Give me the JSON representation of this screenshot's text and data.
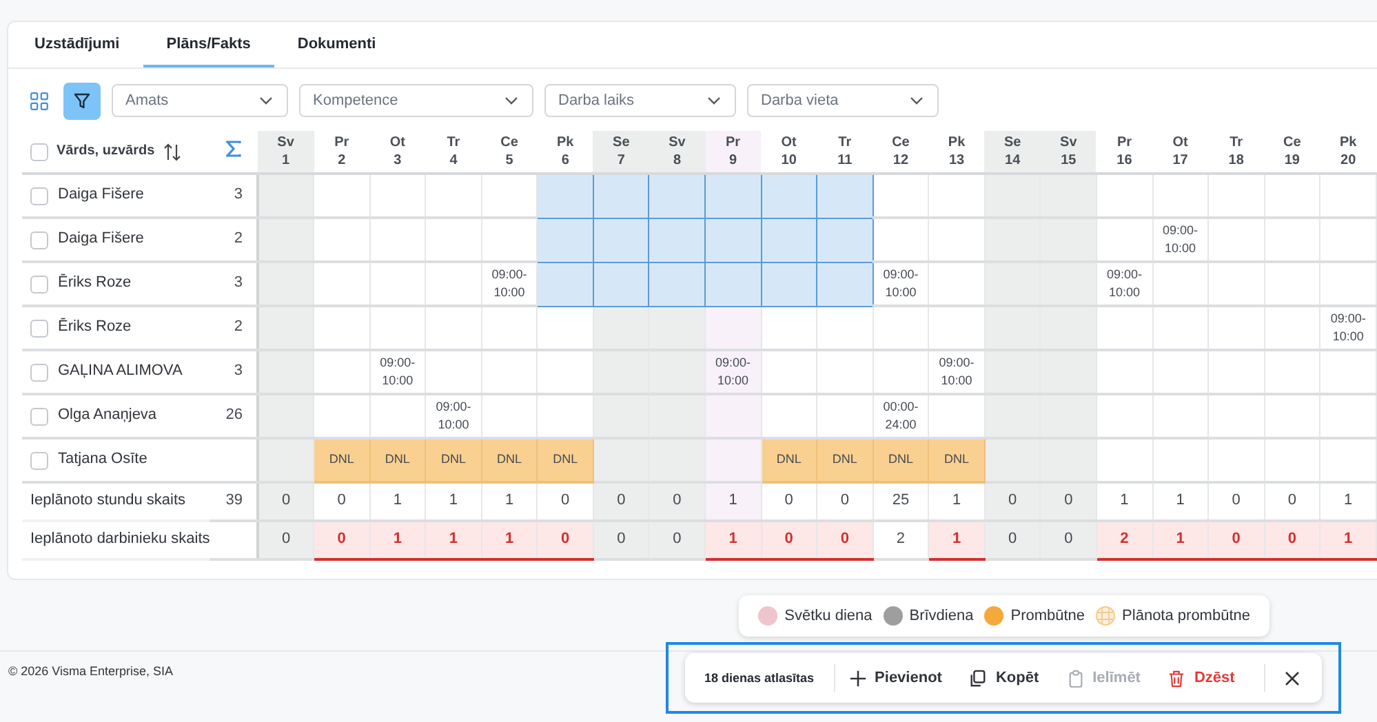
{
  "tabs": [
    {
      "label": "Uzstādījumi",
      "selected": false
    },
    {
      "label": "Plāns/Fakts",
      "selected": true
    },
    {
      "label": "Dokumenti",
      "selected": false
    }
  ],
  "toolbar": {
    "filter_active": true,
    "dropdowns": [
      {
        "placeholder": "Amats"
      },
      {
        "placeholder": "Kompetence"
      },
      {
        "placeholder": "Darba laiks"
      },
      {
        "placeholder": "Darba vieta"
      }
    ]
  },
  "table": {
    "name_header": "Vārds, uzvārds",
    "select_all_checked": false,
    "days": [
      {
        "weekday": "Sv",
        "date": "1",
        "kind": "weekend"
      },
      {
        "weekday": "Pr",
        "date": "2",
        "kind": "workday"
      },
      {
        "weekday": "Ot",
        "date": "3",
        "kind": "workday"
      },
      {
        "weekday": "Tr",
        "date": "4",
        "kind": "workday"
      },
      {
        "weekday": "Ce",
        "date": "5",
        "kind": "workday"
      },
      {
        "weekday": "Pk",
        "date": "6",
        "kind": "workday"
      },
      {
        "weekday": "Se",
        "date": "7",
        "kind": "weekend"
      },
      {
        "weekday": "Sv",
        "date": "8",
        "kind": "weekend"
      },
      {
        "weekday": "Pr",
        "date": "9",
        "kind": "holiday"
      },
      {
        "weekday": "Ot",
        "date": "10",
        "kind": "workday"
      },
      {
        "weekday": "Tr",
        "date": "11",
        "kind": "workday"
      },
      {
        "weekday": "Ce",
        "date": "12",
        "kind": "workday"
      },
      {
        "weekday": "Pk",
        "date": "13",
        "kind": "workday"
      },
      {
        "weekday": "Se",
        "date": "14",
        "kind": "weekend"
      },
      {
        "weekday": "Sv",
        "date": "15",
        "kind": "weekend"
      },
      {
        "weekday": "Pr",
        "date": "16",
        "kind": "workday"
      },
      {
        "weekday": "Ot",
        "date": "17",
        "kind": "workday"
      },
      {
        "weekday": "Tr",
        "date": "18",
        "kind": "workday"
      },
      {
        "weekday": "Ce",
        "date": "19",
        "kind": "workday"
      },
      {
        "weekday": "Pk",
        "date": "20",
        "kind": "workday"
      }
    ],
    "rows": [
      {
        "name": "Daiga Fišere",
        "count": "3",
        "checked": false,
        "cells": [
          {
            "kind": "empty",
            "selected": false
          },
          {
            "kind": "empty",
            "selected": false
          },
          {
            "kind": "empty",
            "selected": false
          },
          {
            "kind": "empty",
            "selected": false
          },
          {
            "kind": "empty",
            "selected": false
          },
          {
            "kind": "empty",
            "selected": true
          },
          {
            "kind": "empty",
            "selected": true
          },
          {
            "kind": "empty",
            "selected": true
          },
          {
            "kind": "empty",
            "selected": true
          },
          {
            "kind": "empty",
            "selected": true
          },
          {
            "kind": "empty",
            "selected": true
          },
          {
            "kind": "empty",
            "selected": false
          },
          {
            "kind": "empty",
            "selected": false
          },
          {
            "kind": "empty",
            "selected": false
          },
          {
            "kind": "empty",
            "selected": false
          },
          {
            "kind": "empty",
            "selected": false
          },
          {
            "kind": "empty",
            "selected": false
          },
          {
            "kind": "empty",
            "selected": false
          },
          {
            "kind": "empty",
            "selected": false
          },
          {
            "kind": "empty",
            "selected": false
          }
        ]
      },
      {
        "name": "Daiga Fišere",
        "count": "2",
        "checked": false,
        "cells": [
          {
            "kind": "empty",
            "selected": false
          },
          {
            "kind": "empty",
            "selected": false
          },
          {
            "kind": "empty",
            "selected": false
          },
          {
            "kind": "empty",
            "selected": false
          },
          {
            "kind": "empty",
            "selected": false
          },
          {
            "kind": "empty",
            "selected": true
          },
          {
            "kind": "empty",
            "selected": true
          },
          {
            "kind": "empty",
            "selected": true
          },
          {
            "kind": "empty",
            "selected": true
          },
          {
            "kind": "empty",
            "selected": true
          },
          {
            "kind": "empty",
            "selected": true
          },
          {
            "kind": "empty",
            "selected": false
          },
          {
            "kind": "empty",
            "selected": false
          },
          {
            "kind": "empty",
            "selected": false
          },
          {
            "kind": "empty",
            "selected": false
          },
          {
            "kind": "empty",
            "selected": false
          },
          {
            "kind": "shift",
            "text": "09:00-\n10:00",
            "selected": false
          },
          {
            "kind": "empty",
            "selected": false
          },
          {
            "kind": "empty",
            "selected": false
          },
          {
            "kind": "empty",
            "selected": false
          }
        ]
      },
      {
        "name": "Ēriks Roze",
        "count": "3",
        "checked": false,
        "cells": [
          {
            "kind": "empty",
            "selected": false
          },
          {
            "kind": "empty",
            "selected": false
          },
          {
            "kind": "empty",
            "selected": false
          },
          {
            "kind": "empty",
            "selected": false
          },
          {
            "kind": "shift",
            "text": "09:00-\n10:00",
            "selected": false
          },
          {
            "kind": "empty",
            "selected": true
          },
          {
            "kind": "empty",
            "selected": true
          },
          {
            "kind": "empty",
            "selected": true
          },
          {
            "kind": "empty",
            "selected": true
          },
          {
            "kind": "empty",
            "selected": true
          },
          {
            "kind": "empty",
            "selected": true
          },
          {
            "kind": "shift",
            "text": "09:00-\n10:00",
            "selected": false
          },
          {
            "kind": "empty",
            "selected": false
          },
          {
            "kind": "empty",
            "selected": false
          },
          {
            "kind": "empty",
            "selected": false
          },
          {
            "kind": "shift",
            "text": "09:00-\n10:00",
            "selected": false
          },
          {
            "kind": "empty",
            "selected": false
          },
          {
            "kind": "empty",
            "selected": false
          },
          {
            "kind": "empty",
            "selected": false
          },
          {
            "kind": "empty",
            "selected": false
          }
        ]
      },
      {
        "name": "Ēriks Roze",
        "count": "2",
        "checked": false,
        "cells": [
          {
            "kind": "empty",
            "selected": false
          },
          {
            "kind": "empty",
            "selected": false
          },
          {
            "kind": "empty",
            "selected": false
          },
          {
            "kind": "empty",
            "selected": false
          },
          {
            "kind": "empty",
            "selected": false
          },
          {
            "kind": "empty",
            "selected": false
          },
          {
            "kind": "empty",
            "selected": false
          },
          {
            "kind": "empty",
            "selected": false
          },
          {
            "kind": "empty",
            "selected": false
          },
          {
            "kind": "empty",
            "selected": false
          },
          {
            "kind": "empty",
            "selected": false
          },
          {
            "kind": "empty",
            "selected": false
          },
          {
            "kind": "empty",
            "selected": false
          },
          {
            "kind": "empty",
            "selected": false
          },
          {
            "kind": "empty",
            "selected": false
          },
          {
            "kind": "empty",
            "selected": false
          },
          {
            "kind": "empty",
            "selected": false
          },
          {
            "kind": "empty",
            "selected": false
          },
          {
            "kind": "empty",
            "selected": false
          },
          {
            "kind": "shift",
            "text": "09:00-\n10:00",
            "selected": false
          }
        ]
      },
      {
        "name": "GAĻINA ALIMOVA",
        "count": "3",
        "checked": false,
        "cells": [
          {
            "kind": "empty",
            "selected": false
          },
          {
            "kind": "empty",
            "selected": false
          },
          {
            "kind": "shift",
            "text": "09:00-\n10:00",
            "selected": false
          },
          {
            "kind": "empty",
            "selected": false
          },
          {
            "kind": "empty",
            "selected": false
          },
          {
            "kind": "empty",
            "selected": false
          },
          {
            "kind": "empty",
            "selected": false
          },
          {
            "kind": "empty",
            "selected": false
          },
          {
            "kind": "shift",
            "text": "09:00-\n10:00",
            "selected": false
          },
          {
            "kind": "empty",
            "selected": false
          },
          {
            "kind": "empty",
            "selected": false
          },
          {
            "kind": "empty",
            "selected": false
          },
          {
            "kind": "shift",
            "text": "09:00-\n10:00",
            "selected": false
          },
          {
            "kind": "empty",
            "selected": false
          },
          {
            "kind": "empty",
            "selected": false
          },
          {
            "kind": "empty",
            "selected": false
          },
          {
            "kind": "empty",
            "selected": false
          },
          {
            "kind": "empty",
            "selected": false
          },
          {
            "kind": "empty",
            "selected": false
          },
          {
            "kind": "empty",
            "selected": false
          }
        ]
      },
      {
        "name": "Olga Anaņjeva",
        "count": "26",
        "checked": false,
        "cells": [
          {
            "kind": "empty",
            "selected": false
          },
          {
            "kind": "empty",
            "selected": false
          },
          {
            "kind": "empty",
            "selected": false
          },
          {
            "kind": "shift",
            "text": "09:00-\n10:00",
            "selected": false
          },
          {
            "kind": "empty",
            "selected": false
          },
          {
            "kind": "empty",
            "selected": false
          },
          {
            "kind": "empty",
            "selected": false
          },
          {
            "kind": "empty",
            "selected": false
          },
          {
            "kind": "empty",
            "selected": false
          },
          {
            "kind": "empty",
            "selected": false
          },
          {
            "kind": "empty",
            "selected": false
          },
          {
            "kind": "shift",
            "text": "00:00-\n24:00",
            "selected": false
          },
          {
            "kind": "empty",
            "selected": false
          },
          {
            "kind": "empty",
            "selected": false
          },
          {
            "kind": "empty",
            "selected": false
          },
          {
            "kind": "empty",
            "selected": false
          },
          {
            "kind": "empty",
            "selected": false
          },
          {
            "kind": "empty",
            "selected": false
          },
          {
            "kind": "empty",
            "selected": false
          },
          {
            "kind": "empty",
            "selected": false
          }
        ]
      },
      {
        "name": "Tatjana Osīte",
        "checked": false,
        "cells": [
          {
            "kind": "empty",
            "selected": false
          },
          {
            "kind": "absence",
            "text": "DNL",
            "selected": false
          },
          {
            "kind": "absence",
            "text": "DNL",
            "selected": false
          },
          {
            "kind": "absence",
            "text": "DNL",
            "selected": false
          },
          {
            "kind": "absence",
            "text": "DNL",
            "selected": false
          },
          {
            "kind": "absence",
            "text": "DNL",
            "selected": false
          },
          {
            "kind": "empty",
            "selected": false
          },
          {
            "kind": "empty",
            "selected": false
          },
          {
            "kind": "empty",
            "selected": false
          },
          {
            "kind": "absence",
            "text": "DNL",
            "selected": false
          },
          {
            "kind": "absence",
            "text": "DNL",
            "selected": false
          },
          {
            "kind": "absence",
            "text": "DNL",
            "selected": false
          },
          {
            "kind": "absence",
            "text": "DNL",
            "selected": false
          },
          {
            "kind": "empty",
            "selected": false
          },
          {
            "kind": "empty",
            "selected": false
          },
          {
            "kind": "empty",
            "selected": false
          },
          {
            "kind": "empty",
            "selected": false
          },
          {
            "kind": "empty",
            "selected": false
          },
          {
            "kind": "empty",
            "selected": false
          },
          {
            "kind": "empty",
            "selected": false
          }
        ]
      }
    ],
    "summary_rows": [
      {
        "label": "Ieplānoto stundu skaits",
        "total": "39",
        "values": [
          {
            "value": "0",
            "warning": false
          },
          {
            "value": "0",
            "warning": false
          },
          {
            "value": "1",
            "warning": false
          },
          {
            "value": "1",
            "warning": false
          },
          {
            "value": "1",
            "warning": false
          },
          {
            "value": "0",
            "warning": false
          },
          {
            "value": "0",
            "warning": false
          },
          {
            "value": "0",
            "warning": false
          },
          {
            "value": "1",
            "warning": false
          },
          {
            "value": "0",
            "warning": false
          },
          {
            "value": "0",
            "warning": false
          },
          {
            "value": "25",
            "warning": false
          },
          {
            "value": "1",
            "warning": false
          },
          {
            "value": "0",
            "warning": false
          },
          {
            "value": "0",
            "warning": false
          },
          {
            "value": "1",
            "warning": false
          },
          {
            "value": "1",
            "warning": false
          },
          {
            "value": "0",
            "warning": false
          },
          {
            "value": "0",
            "warning": false
          },
          {
            "value": "1",
            "warning": false
          }
        ]
      },
      {
        "label": "Ieplānoto darbinieku skaits",
        "values": [
          {
            "value": "0",
            "warning": false
          },
          {
            "value": "0",
            "warning": true
          },
          {
            "value": "1",
            "warning": true
          },
          {
            "value": "1",
            "warning": true
          },
          {
            "value": "1",
            "warning": true
          },
          {
            "value": "0",
            "warning": true
          },
          {
            "value": "0",
            "warning": false
          },
          {
            "value": "0",
            "warning": false
          },
          {
            "value": "1",
            "warning": true
          },
          {
            "value": "0",
            "warning": true
          },
          {
            "value": "0",
            "warning": true
          },
          {
            "value": "2",
            "warning": false
          },
          {
            "value": "1",
            "warning": true
          },
          {
            "value": "0",
            "warning": false
          },
          {
            "value": "0",
            "warning": false
          },
          {
            "value": "2",
            "warning": true
          },
          {
            "value": "1",
            "warning": true
          },
          {
            "value": "0",
            "warning": true
          },
          {
            "value": "0",
            "warning": true
          },
          {
            "value": "1",
            "warning": true
          }
        ]
      }
    ]
  },
  "legend": [
    {
      "label": "Svētku diena",
      "kind": "dot",
      "color": "#f0c4cc"
    },
    {
      "label": "Brīvdiena",
      "kind": "dot",
      "color": "#9e9e9e"
    },
    {
      "label": "Prombūtne",
      "kind": "dot",
      "color": "#f5a93b"
    },
    {
      "label": "Plānota prombūtne",
      "kind": "pattern",
      "color": "#f5c98a"
    }
  ],
  "footer": {
    "copyright": "© 2026 Visma Enterprise, SIA"
  },
  "action_bar": {
    "selection": "18 dienas atlasītas",
    "buttons": [
      {
        "label": "Pievienot",
        "disabled": false,
        "kind": "add"
      },
      {
        "label": "Kopēt",
        "disabled": false,
        "kind": "copy"
      },
      {
        "label": "Ielīmēt",
        "disabled": true,
        "kind": "paste"
      },
      {
        "label": "Dzēst",
        "disabled": false,
        "kind": "delete"
      }
    ]
  }
}
